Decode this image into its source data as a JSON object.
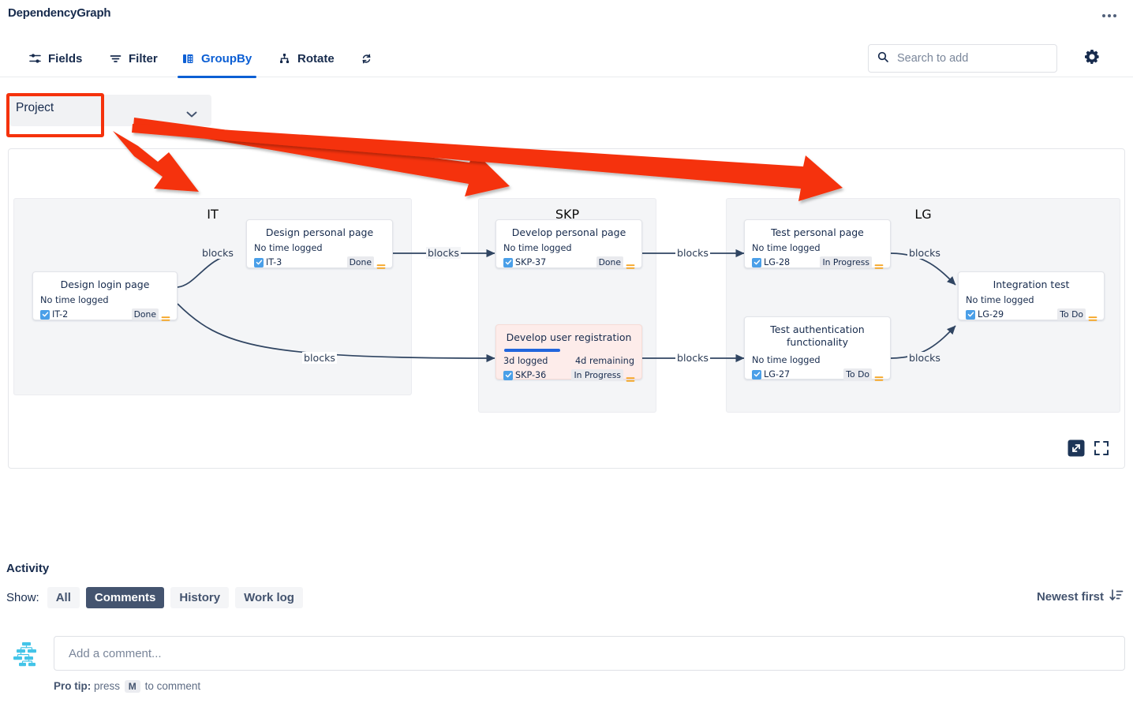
{
  "header": {
    "title": "DependencyGraph",
    "more_menu": "more-options"
  },
  "toolbar": {
    "items": [
      {
        "label": "Fields",
        "icon": "fields-icon",
        "active": false
      },
      {
        "label": "Filter",
        "icon": "filter-icon",
        "active": false
      },
      {
        "label": "GroupBy",
        "icon": "groupby-icon",
        "active": true
      },
      {
        "label": "Rotate",
        "icon": "rotate-icon",
        "active": false
      }
    ],
    "refresh_icon": "refresh-icon",
    "gear_icon": "gear-icon"
  },
  "search": {
    "placeholder": "Search to add",
    "value": "",
    "icon": "search-icon"
  },
  "groupby": {
    "selected": "Project",
    "chevron": "chevron-down-icon"
  },
  "graph": {
    "groups": [
      {
        "name": "IT"
      },
      {
        "name": "SKP"
      },
      {
        "name": "LG"
      }
    ],
    "cards": [
      {
        "title": "Design login page",
        "time": "No time logged",
        "remaining": "",
        "key": "IT-2",
        "status": "Done",
        "progress": 0,
        "highlight": false
      },
      {
        "title": "Design personal page",
        "time": "No time logged",
        "remaining": "",
        "key": "IT-3",
        "status": "Done",
        "progress": 0,
        "highlight": false
      },
      {
        "title": "Develop personal page",
        "time": "No time logged",
        "remaining": "",
        "key": "SKP-37",
        "status": "Done",
        "progress": 0,
        "highlight": false
      },
      {
        "title": "Develop user registration",
        "time": "3d logged",
        "remaining": "4d remaining",
        "key": "SKP-36",
        "status": "In Progress",
        "progress": 43,
        "highlight": true
      },
      {
        "title": "Test personal page",
        "time": "No time logged",
        "remaining": "",
        "key": "LG-28",
        "status": "In Progress",
        "progress": 0,
        "highlight": false
      },
      {
        "title": "Test authentication functionality",
        "time": "No time logged",
        "remaining": "",
        "key": "LG-27",
        "status": "To Do",
        "progress": 0,
        "highlight": false
      },
      {
        "title": "Integration test",
        "time": "No time logged",
        "remaining": "",
        "key": "LG-29",
        "status": "To Do",
        "progress": 0,
        "highlight": false
      }
    ],
    "edges": [
      {
        "label": "blocks",
        "from": "IT-2",
        "to": "IT-3"
      },
      {
        "label": "blocks",
        "from": "IT-3",
        "to": "SKP-37"
      },
      {
        "label": "blocks",
        "from": "IT-2",
        "to": "SKP-36"
      },
      {
        "label": "blocks",
        "from": "SKP-37",
        "to": "LG-28"
      },
      {
        "label": "blocks",
        "from": "SKP-36",
        "to": "LG-27"
      },
      {
        "label": "blocks",
        "from": "LG-28",
        "to": "LG-29"
      },
      {
        "label": "blocks",
        "from": "LG-27",
        "to": "LG-29"
      }
    ],
    "tools": [
      {
        "icon": "expand-diagonal-icon"
      },
      {
        "icon": "fullscreen-icon"
      }
    ]
  },
  "annotations": {
    "highlight_color": "#f5320c",
    "arrow_count": 3,
    "targets": [
      "IT",
      "SKP",
      "LG"
    ]
  },
  "activity": {
    "title": "Activity",
    "show_label": "Show:",
    "filters": [
      {
        "label": "All",
        "selected": false
      },
      {
        "label": "Comments",
        "selected": true
      },
      {
        "label": "History",
        "selected": false
      },
      {
        "label": "Work log",
        "selected": false
      }
    ],
    "sort": {
      "label": "Newest first",
      "icon": "sort-descending-icon"
    },
    "avatar_icon": "hierarchy-tree-icon",
    "comment_placeholder": "Add a comment...",
    "comment_value": "",
    "pro_tip": {
      "prefix": "Pro tip:",
      "mid": "press",
      "key": "M",
      "suffix": "to comment"
    }
  }
}
